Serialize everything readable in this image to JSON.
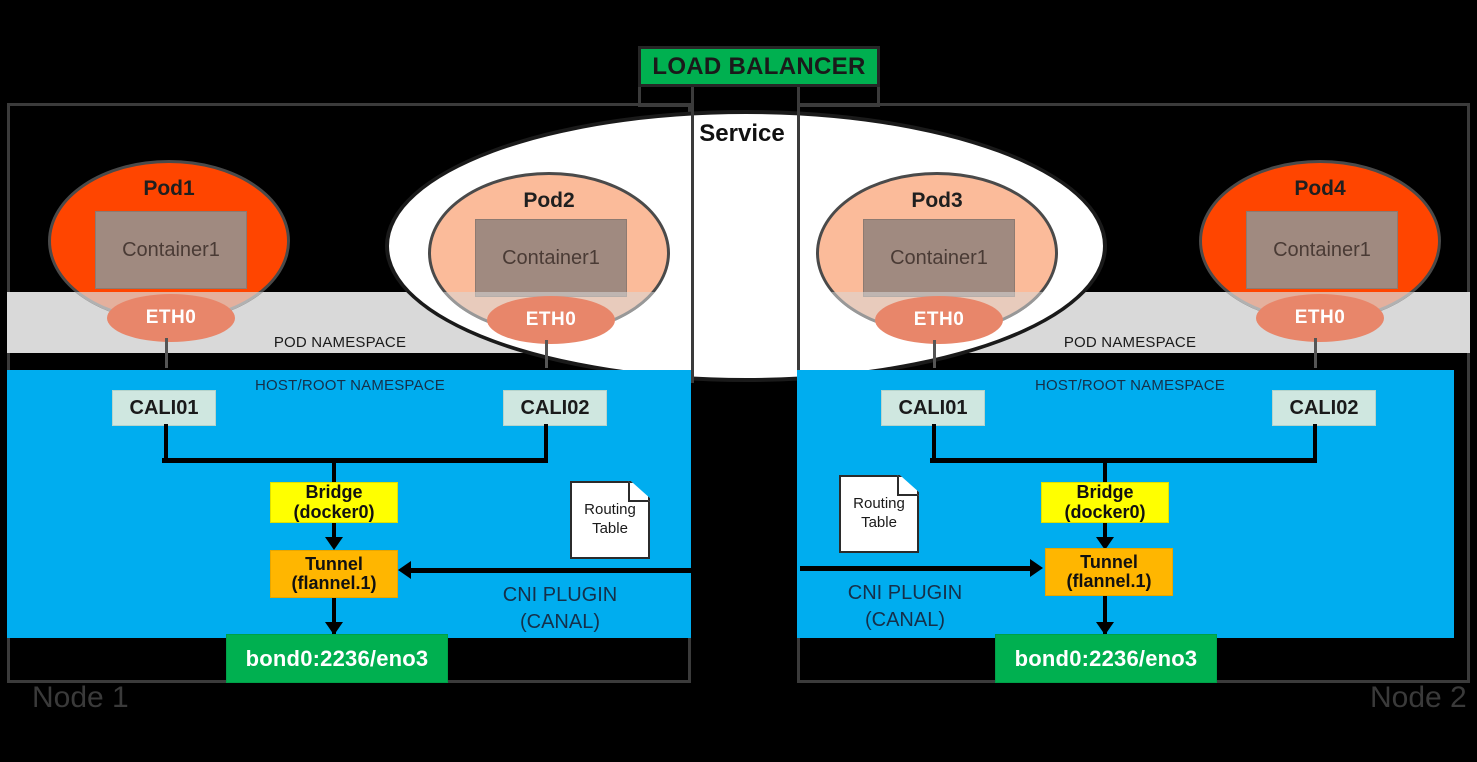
{
  "diagram": {
    "load_balancer": "LOAD BALANCER",
    "service_label": "Service",
    "node1_caption": "Node 1",
    "node2_caption": "Node 2",
    "pod_namespace_label_left": "POD  NAMESPACE",
    "pod_namespace_label_right": "POD NAMESPACE",
    "host_namespace_label": "HOST/ROOT  NAMESPACE",
    "cni_line1": "CNI PLUGIN",
    "cni_line2": "(CANAL)",
    "routing_table_line1": "Routing",
    "routing_table_line2": "Table",
    "bond_label": "bond0:2236/eno3",
    "bridge_line1": "Bridge",
    "bridge_line2": "(docker0)",
    "tunnel_line1": "Tunnel",
    "tunnel_line2": "(flannel.1)",
    "eth0_label": "ETH0",
    "container_label": "Container1",
    "cali01": "CALI01",
    "cali02": "CALI02",
    "pods": [
      {
        "name": "Pod1",
        "container": "Container1",
        "eth": "ETH0"
      },
      {
        "name": "Pod2",
        "container": "Container1",
        "eth": "ETH0"
      },
      {
        "name": "Pod3",
        "container": "Container1",
        "eth": "ETH0"
      },
      {
        "name": "Pod4",
        "container": "Container1",
        "eth": "ETH0"
      }
    ],
    "colors": {
      "load_balancer_green": "#00b050",
      "bond_green": "#00b050",
      "host_namespace_blue": "#00adef",
      "pod_namespace_grey": "#d9d9d9",
      "pod_orange": "#ff4500",
      "pod_light_coral": "#fbbb9a",
      "container_brown": "#a08a80",
      "eth0_salmon": "#e8866a",
      "cali_mint": "#cfe7e0",
      "bridge_yellow": "#ffff00",
      "tunnel_amber": "#ffb600",
      "service_white": "#ffffff",
      "frame_dark": "#3b3b3b"
    }
  }
}
